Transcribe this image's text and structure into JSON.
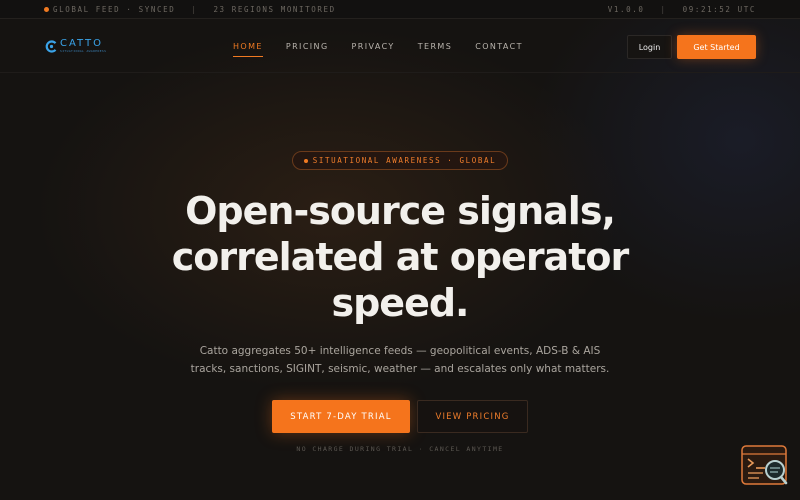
{
  "status_bar": {
    "feed": "GLOBAL FEED · SYNCED",
    "regions": "23 REGIONS MONITORED",
    "version": "V1.0.0",
    "clock": "09:21:52 UTC"
  },
  "brand": {
    "name": "CATTO",
    "tagline": "SITUATIONAL AWARENESS",
    "accent_color": "#3aa3e8"
  },
  "nav": {
    "links": [
      "HOME",
      "PRICING",
      "PRIVACY",
      "TERMS",
      "CONTACT"
    ],
    "active": "HOME",
    "login_label": "Login",
    "cta_label": "Get Started"
  },
  "hero": {
    "badge": "SITUATIONAL AWARENESS · GLOBAL",
    "headline_lines": [
      "Open-source signals,",
      "correlated at operator",
      "speed."
    ],
    "subtitle_lines": [
      "Catto aggregates 50+ intelligence feeds — geopolitical events, ADS-B & AIS",
      "tracks, sanctions, SIGINT, seismic, weather — and escalates only what matters."
    ],
    "primary_cta": "START 7-DAY TRIAL",
    "secondary_cta": "VIEW PRICING",
    "note": "NO CHARGE DURING TRIAL · CANCEL ANYTIME"
  },
  "widget": {
    "icon": "terminal-search-icon"
  },
  "colors": {
    "accent": "#f5741c",
    "background": "#151311"
  }
}
